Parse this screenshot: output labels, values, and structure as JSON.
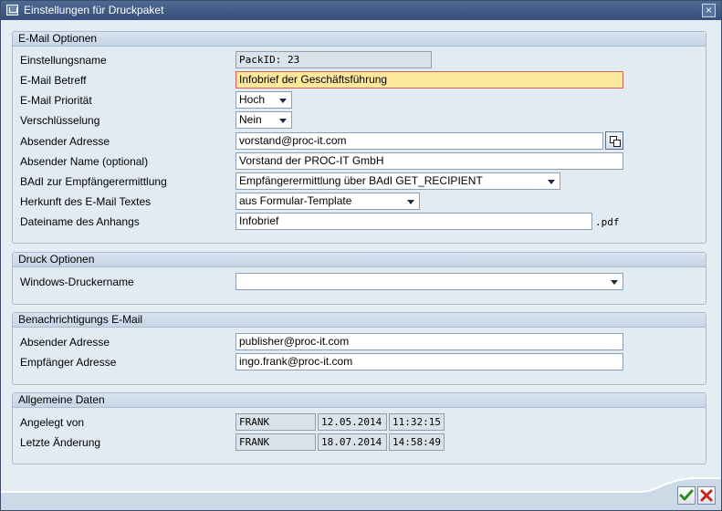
{
  "window": {
    "title": "Einstellungen für Druckpaket",
    "close_label": "×"
  },
  "email_options": {
    "header": "E-Mail Optionen",
    "setting_name": {
      "label": "Einstellungsname",
      "value": "PackID: 23"
    },
    "subject": {
      "label": "E-Mail Betreff",
      "value": "Infobrief der Geschäftsführung"
    },
    "priority": {
      "label": "E-Mail Priorität",
      "value": "Hoch"
    },
    "encryption": {
      "label": "Verschlüsselung",
      "value": "Nein"
    },
    "sender_address": {
      "label": "Absender Adresse",
      "value": "vorstand@proc-it.com"
    },
    "sender_name": {
      "label": "Absender Name (optional)",
      "value": "Vorstand der PROC-IT GmbH"
    },
    "badi": {
      "label": "BAdI zur Empfängerermittlung",
      "value": "Empfängerermittlung über BAdI GET_RECIPIENT"
    },
    "text_source": {
      "label": "Herkunft des E-Mail Textes",
      "value": "aus Formular-Template"
    },
    "attachment_name": {
      "label": "Dateiname des Anhangs",
      "value": "Infobrief",
      "suffix": ".pdf"
    }
  },
  "print_options": {
    "header": "Druck Optionen",
    "printer": {
      "label": "Windows-Druckername",
      "value": ""
    }
  },
  "notification": {
    "header": "Benachrichtigungs E-Mail",
    "sender": {
      "label": "Absender Adresse",
      "value": "publisher@proc-it.com"
    },
    "recipient": {
      "label": "Empfänger Adresse",
      "value": "ingo.frank@proc-it.com"
    }
  },
  "general": {
    "header": "Allgemeine Daten",
    "created": {
      "label": "Angelegt von",
      "user": "FRANK",
      "date": "12.05.2014",
      "time": "11:32:15"
    },
    "changed": {
      "label": "Letzte Änderung",
      "user": "FRANK",
      "date": "18.07.2014",
      "time": "14:58:49"
    }
  },
  "icons": {
    "title": "window-icon",
    "close": "close-icon",
    "copy": "copy-icon",
    "ok": "checkmark-icon",
    "cancel": "cancel-icon"
  },
  "colors": {
    "titlebar": "#3e5a84",
    "highlight_field": "#fde89c",
    "ok_green": "#2e8a1e",
    "cancel_red": "#c2281e"
  }
}
